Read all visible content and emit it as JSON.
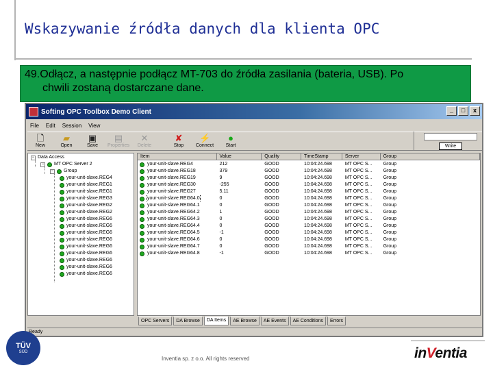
{
  "slide": {
    "title": "Wskazywanie źródła danych dla klienta OPC",
    "step_line1": "49.Odłącz, a następnie podłącz MT-703 do źródła zasilania (bateria, USB). Po",
    "step_line2": "chwili zostaną dostarczane dane.",
    "copyright": "Inventia sp. z o.o. All rights reserved",
    "logo_part1": "in",
    "logo_part2": "V",
    "logo_part3": "entia",
    "tuv_line1": "TÜV",
    "tuv_line2": "SÜD"
  },
  "window": {
    "title": "Softing OPC Toolbox Demo Client",
    "min": "_",
    "max": "□",
    "close": "x"
  },
  "menu": [
    "File",
    "Edit",
    "Session",
    "View"
  ],
  "toolbar": {
    "new": "New",
    "open": "Open",
    "save": "Save",
    "properties": "Properties",
    "delete": "Delete",
    "stop": "Stop",
    "connect": "Connect",
    "start": "Start",
    "write": "Write"
  },
  "tree": {
    "root": "Data Access",
    "server": "MT OPC Server 2",
    "group": "Group",
    "items": [
      "your-unit-slave.REG4",
      "your-unit-slave.REG1",
      "your-unit-slave.REG1",
      "your-unit-slave.REG3",
      "your-unit-slave.REG2",
      "your-unit-slave.REG2",
      "your-unit-slave.REG6",
      "your-unit-slave.REG6",
      "your-unit-slave.REG6",
      "your-unit-slave.REG6",
      "your-unit-slave.REG6",
      "your-unit-slave.REG6",
      "your-unit-slave.REG6",
      "your-unit-slave.REG6",
      "your-unit-slave.REG6"
    ]
  },
  "list": {
    "headers": [
      "Item",
      "Value",
      "Quality",
      "TimeStamp",
      "Server",
      "Group"
    ],
    "rows": [
      {
        "item": "your-unit-slave.REG4",
        "value": "212",
        "quality": "GOOD",
        "ts": "10:04:24.698",
        "server": "MT OPC S...",
        "group": "Group"
      },
      {
        "item": "your-unit-slave.REG18",
        "value": "379",
        "quality": "GOOD",
        "ts": "10:04:24.698",
        "server": "MT OPC S...",
        "group": "Group"
      },
      {
        "item": "your-unit-slave.REG19",
        "value": "9",
        "quality": "GOOD",
        "ts": "10:04:24.698",
        "server": "MT OPC S...",
        "group": "Group"
      },
      {
        "item": "your-unit-slave.REG30",
        "value": "-255",
        "quality": "GOOD",
        "ts": "10:04:24.698",
        "server": "MT OPC S...",
        "group": "Group"
      },
      {
        "item": "your-unit-slave.REG27",
        "value": "5.11",
        "quality": "GOOD",
        "ts": "10:04:24.698",
        "server": "MT OPC S...",
        "group": "Group"
      },
      {
        "item": "your-unit-slave.REG64.0",
        "value": "0",
        "quality": "GOOD",
        "ts": "10:04:24.698",
        "server": "MT OPC S...",
        "group": "Group"
      },
      {
        "item": "your-unit-slave.REG64.1",
        "value": "0",
        "quality": "GOOD",
        "ts": "10:04:24.698",
        "server": "MT OPC S...",
        "group": "Group"
      },
      {
        "item": "your-unit-slave.REG64.2",
        "value": "1",
        "quality": "GOOD",
        "ts": "10:04:24.698",
        "server": "MT OPC S...",
        "group": "Group"
      },
      {
        "item": "your-unit-slave.REG64.3",
        "value": "0",
        "quality": "GOOD",
        "ts": "10:04:24.698",
        "server": "MT OPC S...",
        "group": "Group"
      },
      {
        "item": "your-unit-slave.REG64.4",
        "value": "0",
        "quality": "GOOD",
        "ts": "10:04:24.698",
        "server": "MT OPC S...",
        "group": "Group"
      },
      {
        "item": "your-unit-slave.REG64.5",
        "value": "-1",
        "quality": "GOOD",
        "ts": "10:04:24.698",
        "server": "MT OPC S...",
        "group": "Group"
      },
      {
        "item": "your-unit-slave.REG64.6",
        "value": "0",
        "quality": "GOOD",
        "ts": "10:04:24.698",
        "server": "MT OPC S...",
        "group": "Group"
      },
      {
        "item": "your-unit-slave.REG64.7",
        "value": "0",
        "quality": "GOOD",
        "ts": "10:04:24.698",
        "server": "MT OPC S...",
        "group": "Group"
      },
      {
        "item": "your-unit-slave.REG64.8",
        "value": "-1",
        "quality": "GOOD",
        "ts": "10:04:24.698",
        "server": "MT OPC S...",
        "group": "Group"
      }
    ]
  },
  "tabs": [
    "OPC Servers",
    "DA Browse",
    "DA Items",
    "AE Browse",
    "AE Events",
    "AE Conditions",
    "Errors"
  ],
  "status": "Ready",
  "colors": {
    "step_box": "#0f9a45",
    "title": "#1f2f95",
    "status_dot": "#1fa81f"
  }
}
